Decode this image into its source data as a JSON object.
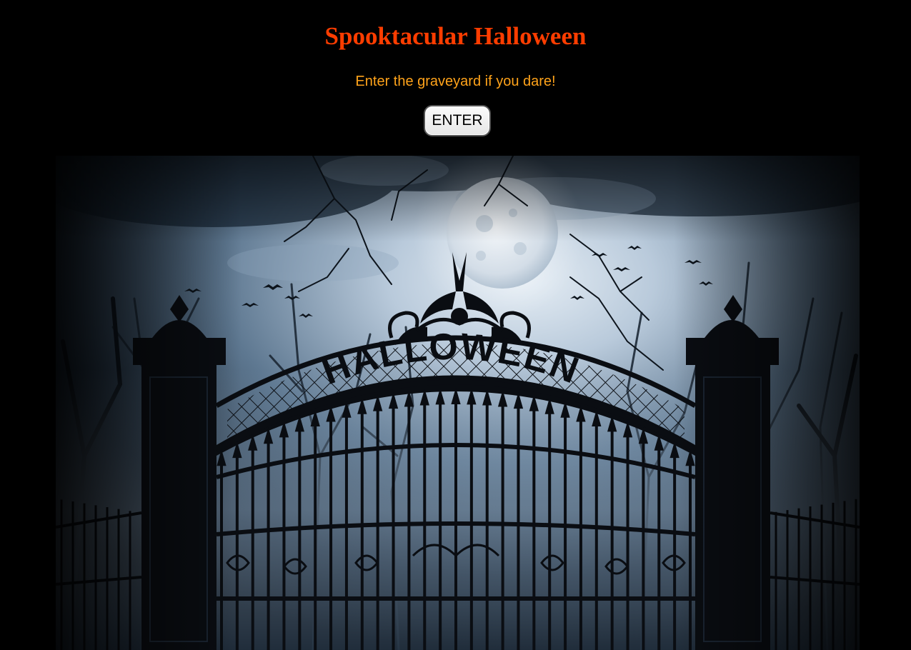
{
  "header": {
    "title": "Spooktacular Halloween",
    "subtitle": "Enter the graveyard if you dare!",
    "enter_label": "ENTER"
  },
  "scene": {
    "gate_sign": "HALLOWEEN",
    "icon": "graveyard-gate-illustration"
  },
  "colors": {
    "background": "#000000",
    "title": "#ff3d00",
    "subtitle": "#ffa31a",
    "sky_light": "#c9d8e6",
    "sky_dark": "#0b1520",
    "iron": "#0a0d12"
  }
}
